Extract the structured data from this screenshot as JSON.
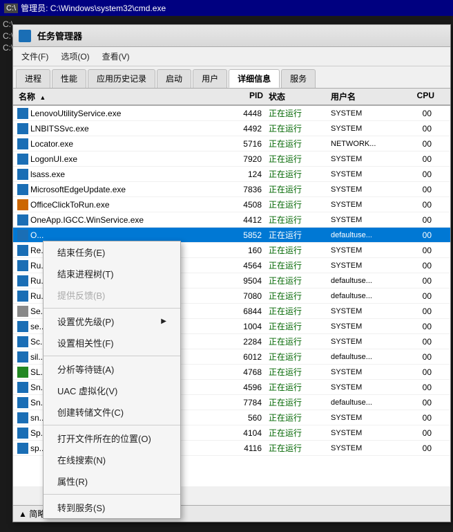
{
  "cmd": {
    "title": "管理员: C:\\Windows\\system32\\cmd.exe",
    "lines": [
      "C:\\",
      "C:\\",
      "C:\\"
    ]
  },
  "taskmgr": {
    "title": "任务管理器",
    "menu": [
      "文件(F)",
      "选项(O)",
      "查看(V)"
    ],
    "tabs": [
      "进程",
      "性能",
      "应用历史记录",
      "启动",
      "用户",
      "详细信息",
      "服务"
    ],
    "active_tab": "详细信息",
    "columns": [
      "名称",
      "PID",
      "状态",
      "用户名",
      "CPU"
    ],
    "processes": [
      {
        "name": "LenovoUtilityService.exe",
        "pid": "4448",
        "status": "正在运行",
        "user": "SYSTEM",
        "cpu": "00",
        "icon": "blue"
      },
      {
        "name": "LNBITSSvc.exe",
        "pid": "4492",
        "status": "正在运行",
        "user": "SYSTEM",
        "cpu": "00",
        "icon": "blue"
      },
      {
        "name": "Locator.exe",
        "pid": "5716",
        "status": "正在运行",
        "user": "NETWORK...",
        "cpu": "00",
        "icon": "blue"
      },
      {
        "name": "LogonUI.exe",
        "pid": "7920",
        "status": "正在运行",
        "user": "SYSTEM",
        "cpu": "00",
        "icon": "blue"
      },
      {
        "name": "lsass.exe",
        "pid": "124",
        "status": "正在运行",
        "user": "SYSTEM",
        "cpu": "00",
        "icon": "blue"
      },
      {
        "name": "MicrosoftEdgeUpdate.exe",
        "pid": "7836",
        "status": "正在运行",
        "user": "SYSTEM",
        "cpu": "00",
        "icon": "blue"
      },
      {
        "name": "OfficeClickToRun.exe",
        "pid": "4508",
        "status": "正在运行",
        "user": "SYSTEM",
        "cpu": "00",
        "icon": "orange"
      },
      {
        "name": "OneApp.IGCC.WinService.exe",
        "pid": "4412",
        "status": "正在运行",
        "user": "SYSTEM",
        "cpu": "00",
        "icon": "blue"
      },
      {
        "name": "O...",
        "pid": "5852",
        "status": "正在运行",
        "user": "defaultuse...",
        "cpu": "00",
        "icon": "blue",
        "selected": true
      },
      {
        "name": "Re...",
        "pid": "160",
        "status": "正在运行",
        "user": "SYSTEM",
        "cpu": "00",
        "icon": "blue"
      },
      {
        "name": "Ru...",
        "pid": "4564",
        "status": "正在运行",
        "user": "SYSTEM",
        "cpu": "00",
        "icon": "blue"
      },
      {
        "name": "Ru...",
        "pid": "9504",
        "status": "正在运行",
        "user": "defaultuse...",
        "cpu": "00",
        "icon": "blue"
      },
      {
        "name": "Ru...",
        "pid": "7080",
        "status": "正在运行",
        "user": "defaultuse...",
        "cpu": "00",
        "icon": "blue"
      },
      {
        "name": "Se...",
        "pid": "6844",
        "status": "正在运行",
        "user": "SYSTEM",
        "cpu": "00",
        "icon": "gray"
      },
      {
        "name": "se...",
        "pid": "1004",
        "status": "正在运行",
        "user": "SYSTEM",
        "cpu": "00",
        "icon": "blue"
      },
      {
        "name": "Sc...",
        "pid": "2284",
        "status": "正在运行",
        "user": "SYSTEM",
        "cpu": "00",
        "icon": "blue"
      },
      {
        "name": "sil...",
        "pid": "6012",
        "status": "正在运行",
        "user": "defaultuse...",
        "cpu": "00",
        "icon": "blue"
      },
      {
        "name": "SL...",
        "pid": "4768",
        "status": "正在运行",
        "user": "SYSTEM",
        "cpu": "00",
        "icon": "green"
      },
      {
        "name": "Sn...",
        "pid": "4596",
        "status": "正在运行",
        "user": "SYSTEM",
        "cpu": "00",
        "icon": "blue"
      },
      {
        "name": "Sn...",
        "pid": "7784",
        "status": "正在运行",
        "user": "defaultuse...",
        "cpu": "00",
        "icon": "blue"
      },
      {
        "name": "sn...",
        "pid": "560",
        "status": "正在运行",
        "user": "SYSTEM",
        "cpu": "00",
        "icon": "blue"
      },
      {
        "name": "Sp...",
        "pid": "4104",
        "status": "正在运行",
        "user": "SYSTEM",
        "cpu": "00",
        "icon": "blue"
      },
      {
        "name": "sp...",
        "pid": "4116",
        "status": "正在运行",
        "user": "SYSTEM",
        "cpu": "00",
        "icon": "blue"
      }
    ],
    "context_menu": [
      {
        "label": "结束任务(E)",
        "type": "item"
      },
      {
        "label": "结束进程树(T)",
        "type": "item"
      },
      {
        "label": "提供反馈(B)",
        "type": "item",
        "disabled": true
      },
      {
        "type": "separator"
      },
      {
        "label": "设置优先级(P)",
        "type": "item",
        "submenu": true
      },
      {
        "label": "设置相关性(F)",
        "type": "item"
      },
      {
        "type": "separator"
      },
      {
        "label": "分析等待链(A)",
        "type": "item"
      },
      {
        "label": "UAC 虚拟化(V)",
        "type": "item"
      },
      {
        "label": "创建转储文件(C)",
        "type": "item"
      },
      {
        "type": "separator"
      },
      {
        "label": "打开文件所在的位置(O)",
        "type": "item"
      },
      {
        "label": "在线搜索(N)",
        "type": "item"
      },
      {
        "label": "属性(R)",
        "type": "item"
      },
      {
        "type": "separator"
      },
      {
        "label": "转到服务(S)",
        "type": "item"
      }
    ],
    "statusbar": "▲ 简略信息(D)"
  }
}
